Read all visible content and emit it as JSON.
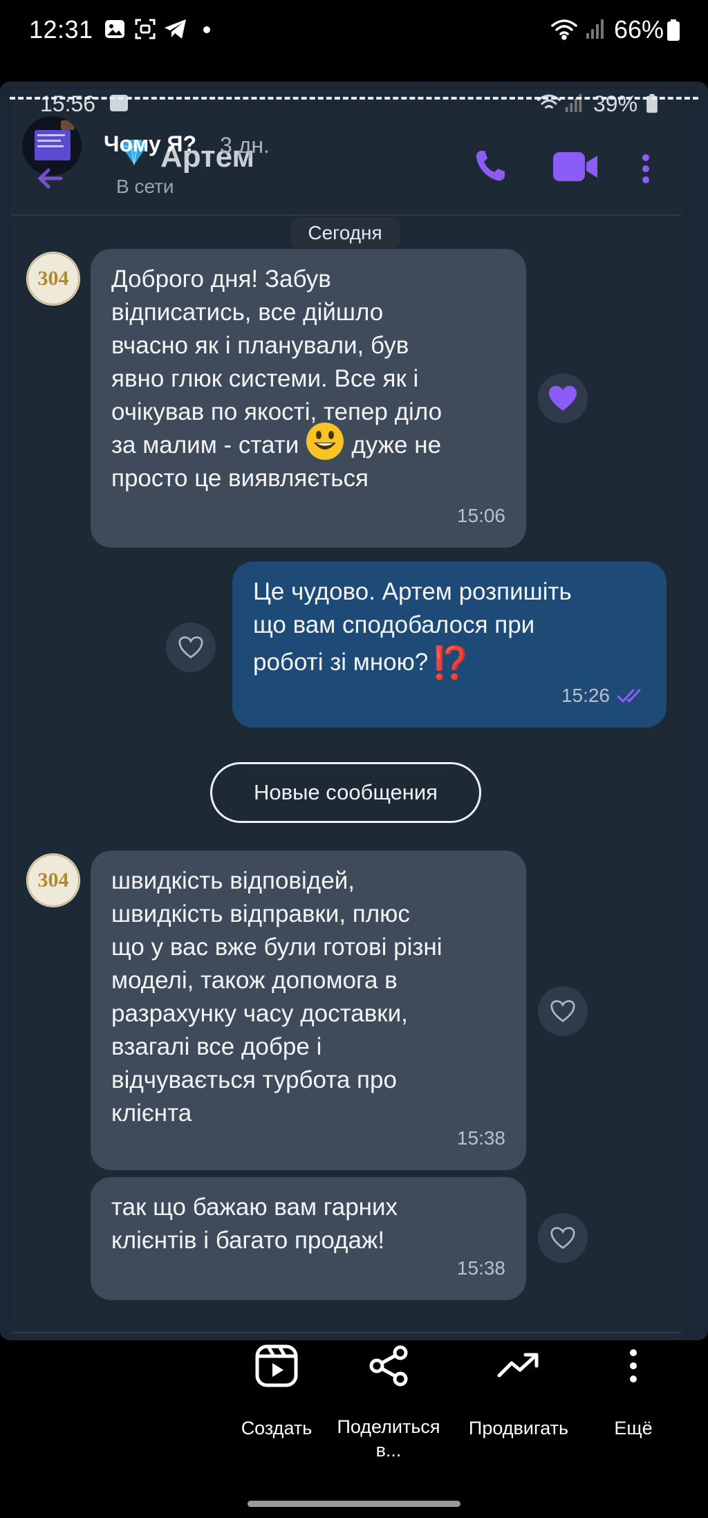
{
  "status_bar": {
    "time": "12:31",
    "battery": "66%"
  },
  "inner_status_bar": {
    "time": "15:56",
    "battery": "39%"
  },
  "story": {
    "title": "Чому Я?",
    "age": "3 дн."
  },
  "chat": {
    "name": "Артем",
    "status": "В сети"
  },
  "date_chip": "Сегодня",
  "messages": [
    {
      "direction": "in",
      "lines": [
        "Доброго дня! Забув",
        "відписатись, все дійшло",
        "вчасно як і планували, був",
        "явно глюк системи. Все як і",
        "очікував по якості, тепер діло",
        "за малим - стати",
        "просто це виявляється"
      ],
      "emoji_line_suffix": "дуже не",
      "time": "15:06",
      "reaction": "filled-heart"
    },
    {
      "direction": "out",
      "lines": [
        "Це чудово. Артем розпишіть",
        "що вам сподобалося при",
        "роботі зі мною?"
      ],
      "trailing": "⁉️",
      "time": "15:26",
      "reaction": "outline-heart"
    },
    {
      "direction": "in",
      "lines": [
        "швидкість відповідей,",
        "швидкість відправки, плюс",
        "що у вас вже були готові різні",
        "моделі, також допомога в",
        "разрахунку часу доставки,",
        "взагалі все добре і",
        "відчувається турбота про",
        "клієнта"
      ],
      "time": "15:38",
      "reaction": "outline-heart"
    },
    {
      "direction": "in",
      "lines": [
        "так що бажаю вам гарних",
        "клієнтів і багато продаж!"
      ],
      "time": "15:38",
      "reaction": "outline-heart"
    }
  ],
  "new_messages_label": "Новые сообщения",
  "avatar_text": "304",
  "actions": [
    {
      "icon": "reel-play-icon",
      "label": "Создать"
    },
    {
      "icon": "share-icon",
      "label": "Поделиться в..."
    },
    {
      "icon": "trending-up-icon",
      "label": "Продвигать"
    },
    {
      "icon": "more-vertical-icon",
      "label": "Ещё"
    }
  ],
  "colors": {
    "accent": "#8b5cf6",
    "incoming_bubble": "#3f4b5a",
    "outgoing_bubble": "#1e4a77",
    "background": "#1e2936"
  }
}
